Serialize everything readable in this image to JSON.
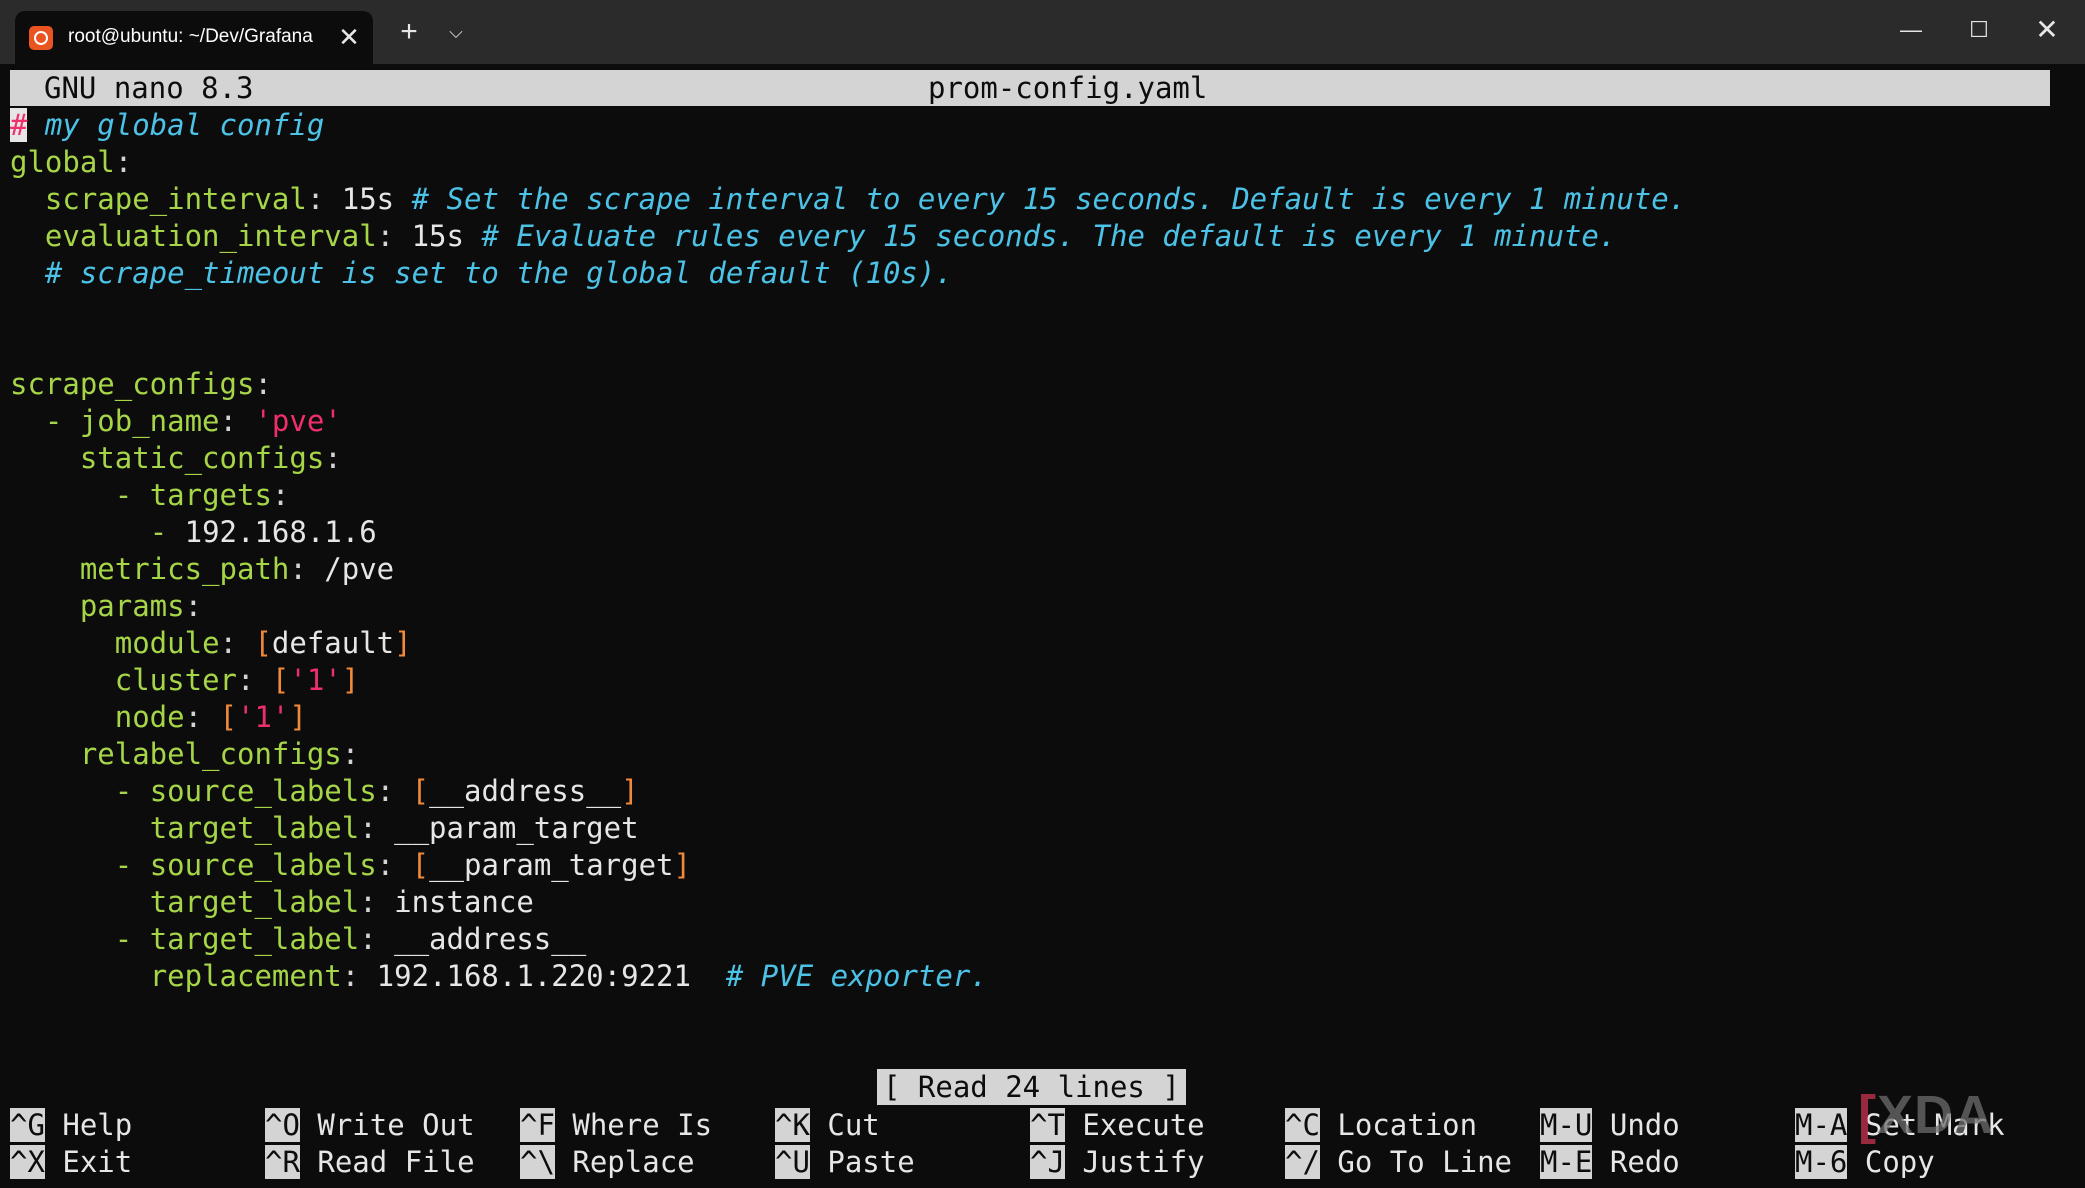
{
  "window": {
    "tab_title": "root@ubuntu: ~/Dev/Grafana",
    "new_tab": "+",
    "tab_menu": "⌵",
    "close_tab": "✕",
    "minimize": "—",
    "maximize": "☐",
    "close": "✕"
  },
  "nano": {
    "app": "GNU nano 8.3",
    "filename": "prom-config.yaml",
    "status": "[ Read 24 lines ]"
  },
  "file": {
    "l1_comment": " my global config",
    "l2_key": "global",
    "l3_key": "scrape_interval",
    "l3_val": "15s",
    "l3_comment": "# Set the scrape interval to every 15 seconds. Default is every 1 minute.",
    "l4_key": "evaluation_interval",
    "l4_val": "15s",
    "l4_comment": "# Evaluate rules every 15 seconds. The default is every 1 minute.",
    "l5_comment": "# scrape_timeout is set to the global default (10s).",
    "l8_key": "scrape_configs",
    "l9_key": "job_name",
    "l9_val": "'pve'",
    "l10_key": "static_configs",
    "l11_key": "targets",
    "l12_val": "192.168.1.6",
    "l13_key": "metrics_path",
    "l13_val": "/pve",
    "l14_key": "params",
    "l15_key": "module",
    "l15_val": "default",
    "l16_key": "cluster",
    "l16_val": "'1'",
    "l17_key": "node",
    "l17_val": "'1'",
    "l18_key": "relabel_configs",
    "l19_key": "source_labels",
    "l19_val": "__address__",
    "l20_key": "target_label",
    "l20_val": "__param_target",
    "l21_key": "source_labels",
    "l21_val": "__param_target",
    "l22_key": "target_label",
    "l22_val": "instance",
    "l23_key": "target_label",
    "l23_val": "__address__",
    "l24_key": "replacement",
    "l24_val": "192.168.1.220:9221",
    "l24_comment": "# PVE exporter."
  },
  "shortcuts": [
    {
      "key": "^G",
      "label": "Help"
    },
    {
      "key": "^X",
      "label": "Exit"
    },
    {
      "key": "^O",
      "label": "Write Out"
    },
    {
      "key": "^R",
      "label": "Read File"
    },
    {
      "key": "^F",
      "label": "Where Is"
    },
    {
      "key": "^\\",
      "label": "Replace"
    },
    {
      "key": "^K",
      "label": "Cut"
    },
    {
      "key": "^U",
      "label": "Paste"
    },
    {
      "key": "^T",
      "label": "Execute"
    },
    {
      "key": "^J",
      "label": "Justify"
    },
    {
      "key": "^C",
      "label": "Location"
    },
    {
      "key": "^/",
      "label": "Go To Line"
    },
    {
      "key": "M-U",
      "label": "Undo"
    },
    {
      "key": "M-E",
      "label": "Redo"
    },
    {
      "key": "M-A",
      "label": "Set Mark"
    },
    {
      "key": "M-6",
      "label": "Copy"
    }
  ],
  "watermark": {
    "pre": "[",
    "text": "XDA"
  },
  "colors": {
    "keyword": "#a6d648",
    "comment": "#4cc2e6",
    "string": "#ee2f6c",
    "bracket": "#f08a3a",
    "background": "#0c0c0c",
    "bar": "#d4d4d4"
  }
}
